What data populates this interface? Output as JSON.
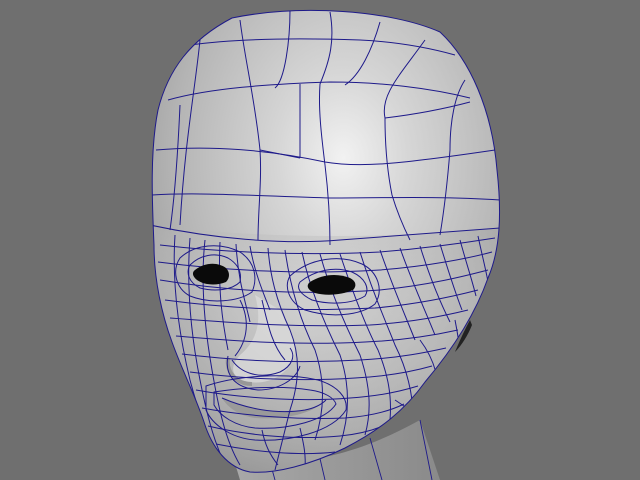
{
  "viewport": {
    "background": "#6f6f6f",
    "shading": "smooth-shade-with-wireframe",
    "model_color": "#bdbdbd",
    "highlight_color": "#f2f2f2",
    "wireframe_color": "#1e1a8a",
    "eye_color": "#0a0a0a"
  }
}
